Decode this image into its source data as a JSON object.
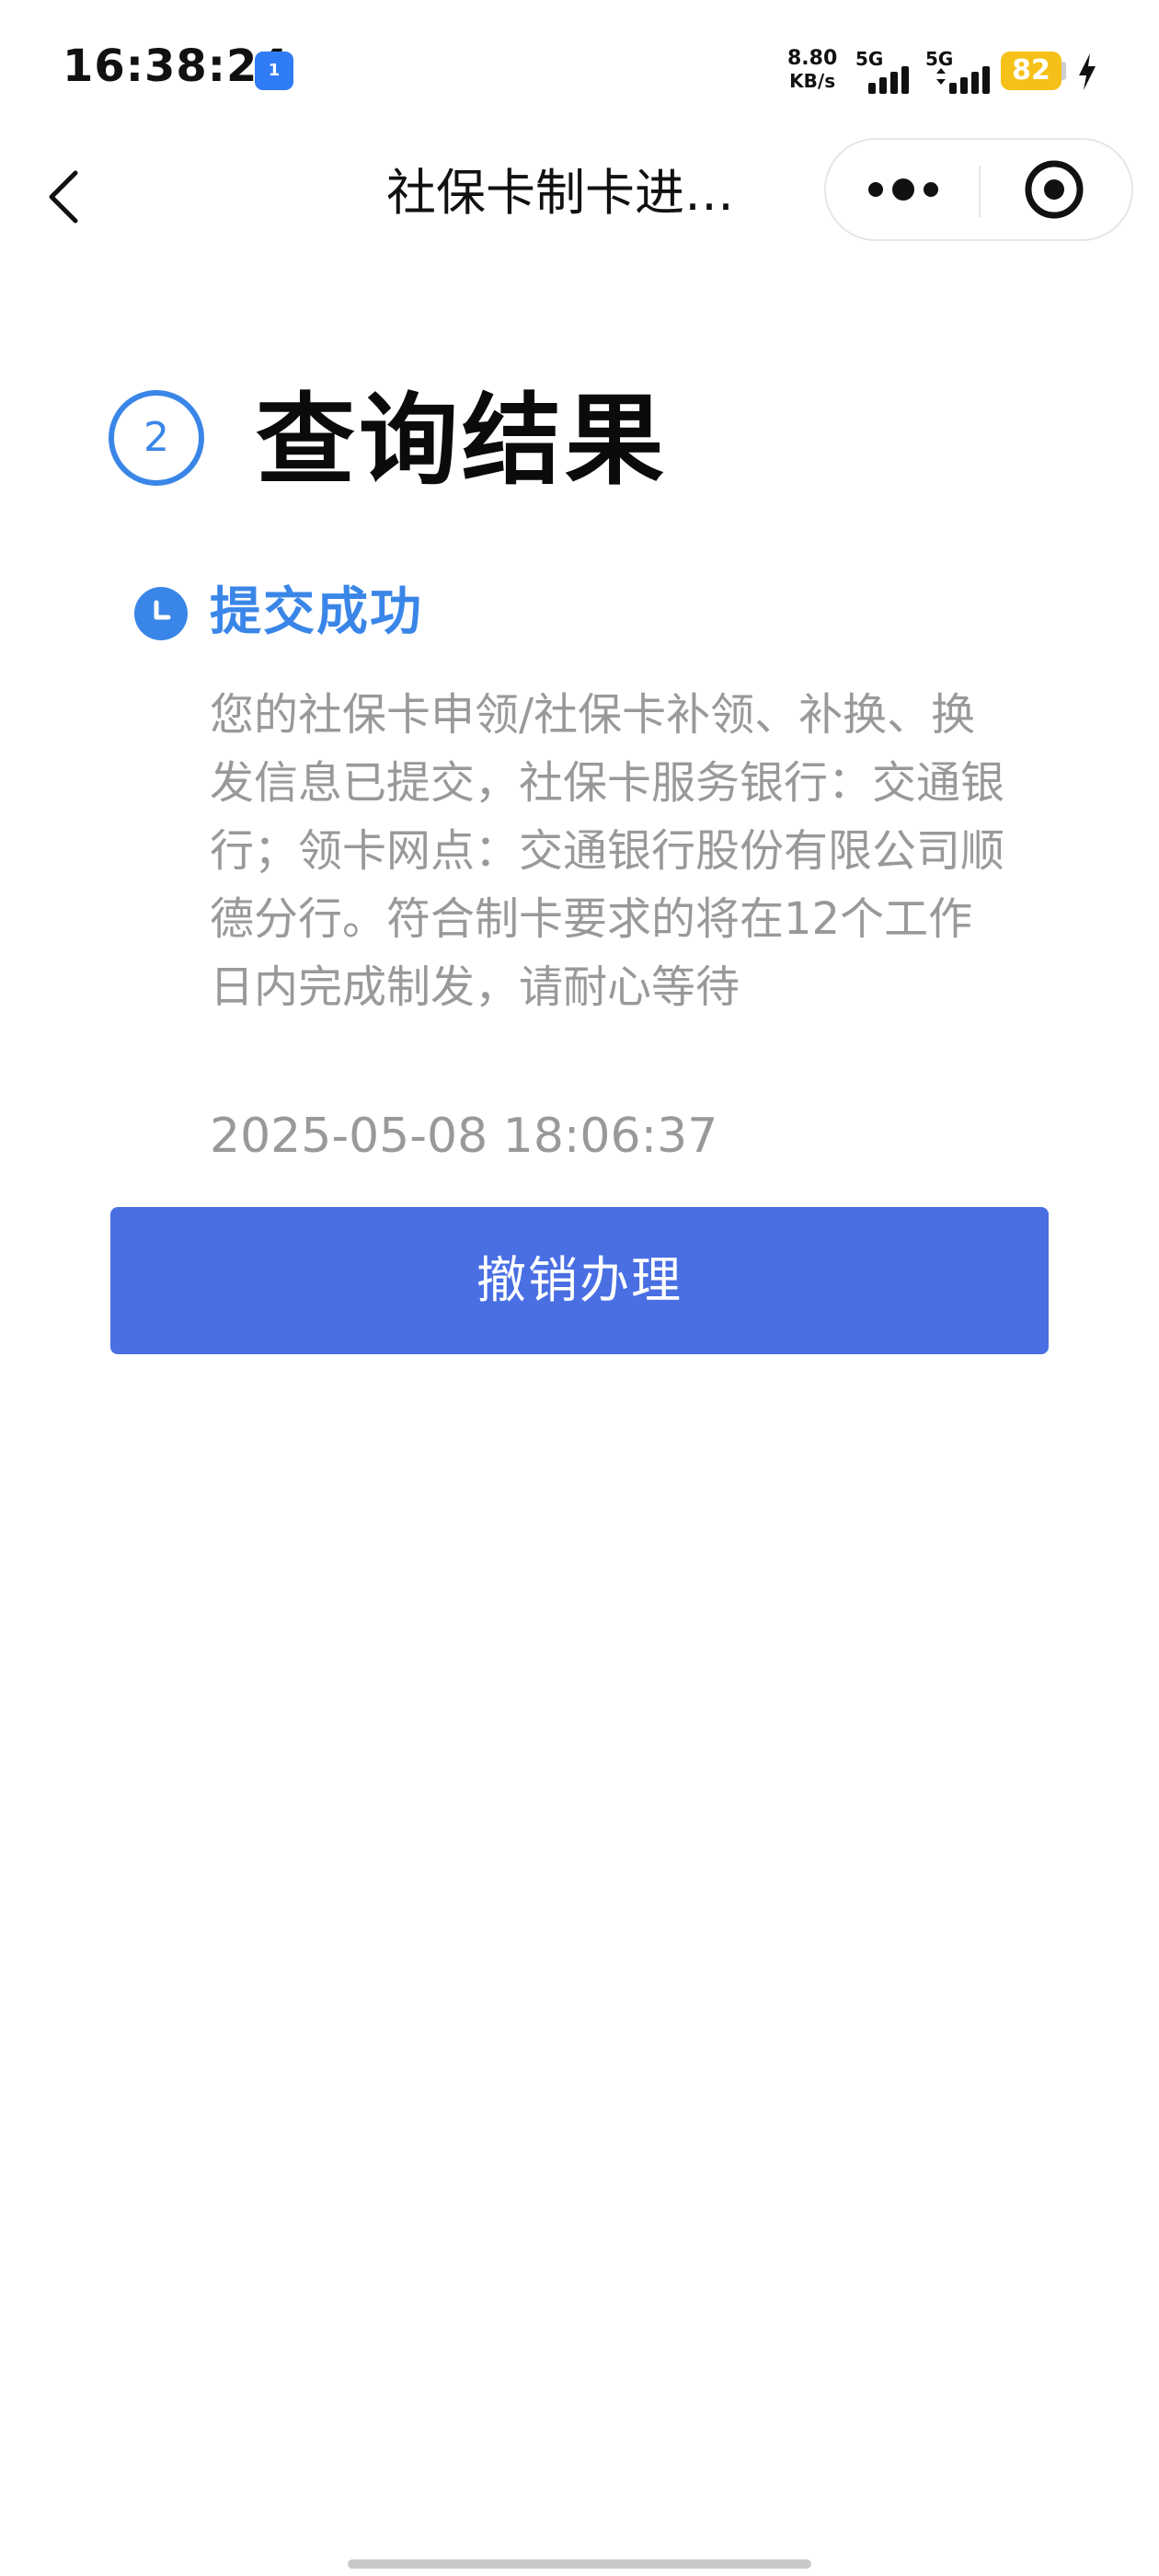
{
  "status_bar": {
    "time": "16:38:24",
    "app_badge": "1",
    "net_speed_value": "8.80",
    "net_speed_unit": "KB/s",
    "sim1_network": "5G",
    "sim2_network": "5G",
    "battery_level": "82",
    "charging": true,
    "battery_color": "#f5c118",
    "icons": [
      "broadcast-app-icon",
      "signal-icon",
      "signal-icon",
      "battery-icon",
      "charging-icon"
    ]
  },
  "nav": {
    "title": "社保卡制卡进…",
    "icons": [
      "back-arrow-icon",
      "more-dots-icon",
      "target-close-icon"
    ]
  },
  "step": {
    "number": "2",
    "title": "查询结果",
    "accent_color": "#3a86e8"
  },
  "timeline": {
    "status_title": "提交成功",
    "description": "您的社保卡申领/社保卡补领、补换、换发信息已提交，社保卡服务银行：交通银行；领卡网点：交通银行股份有限公司顺德分行。符合制卡要求的将在12个工作日内完成制发，请耐心等待",
    "timestamp": "2025-05-08 18:06:37",
    "icon": "clock-icon"
  },
  "actions": {
    "cancel_label": "撤销办理",
    "button_color": "#4a6fe3"
  }
}
